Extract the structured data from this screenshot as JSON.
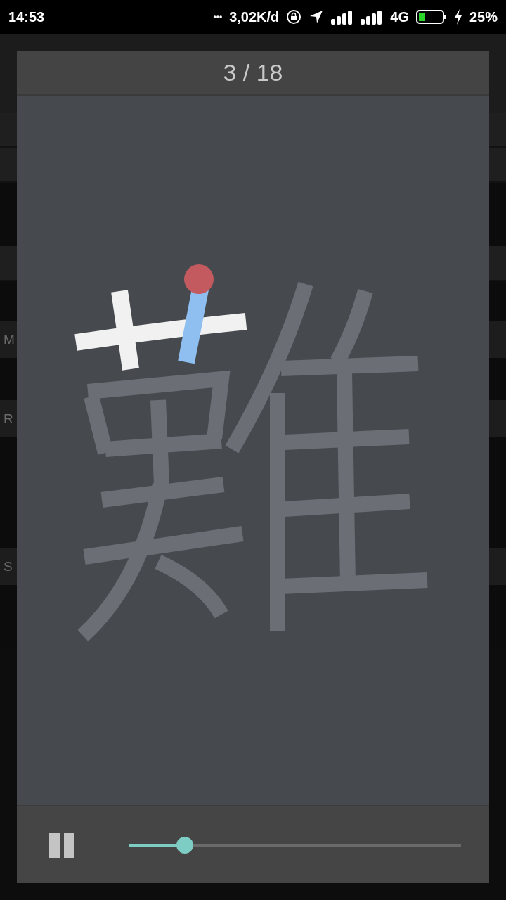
{
  "status_bar": {
    "time": "14:53",
    "dots": "•••",
    "speed": "3,02K/d",
    "network": "4G",
    "battery": "25%"
  },
  "background_rows": [
    {
      "kind": "band"
    },
    {
      "kind": "band"
    },
    {
      "kind": "gap_wide"
    },
    {
      "kind": "band"
    },
    {
      "kind": "gap_small"
    },
    {
      "kind": "header",
      "label": "M"
    },
    {
      "kind": "gap"
    },
    {
      "kind": "header",
      "label": "R"
    },
    {
      "kind": "gap_tall"
    },
    {
      "kind": "header",
      "label": "S"
    },
    {
      "kind": "gap_wide"
    }
  ],
  "dialog": {
    "counter": "3 / 18",
    "player": {
      "playing": true,
      "progress": {
        "level": 0.167
      }
    }
  }
}
